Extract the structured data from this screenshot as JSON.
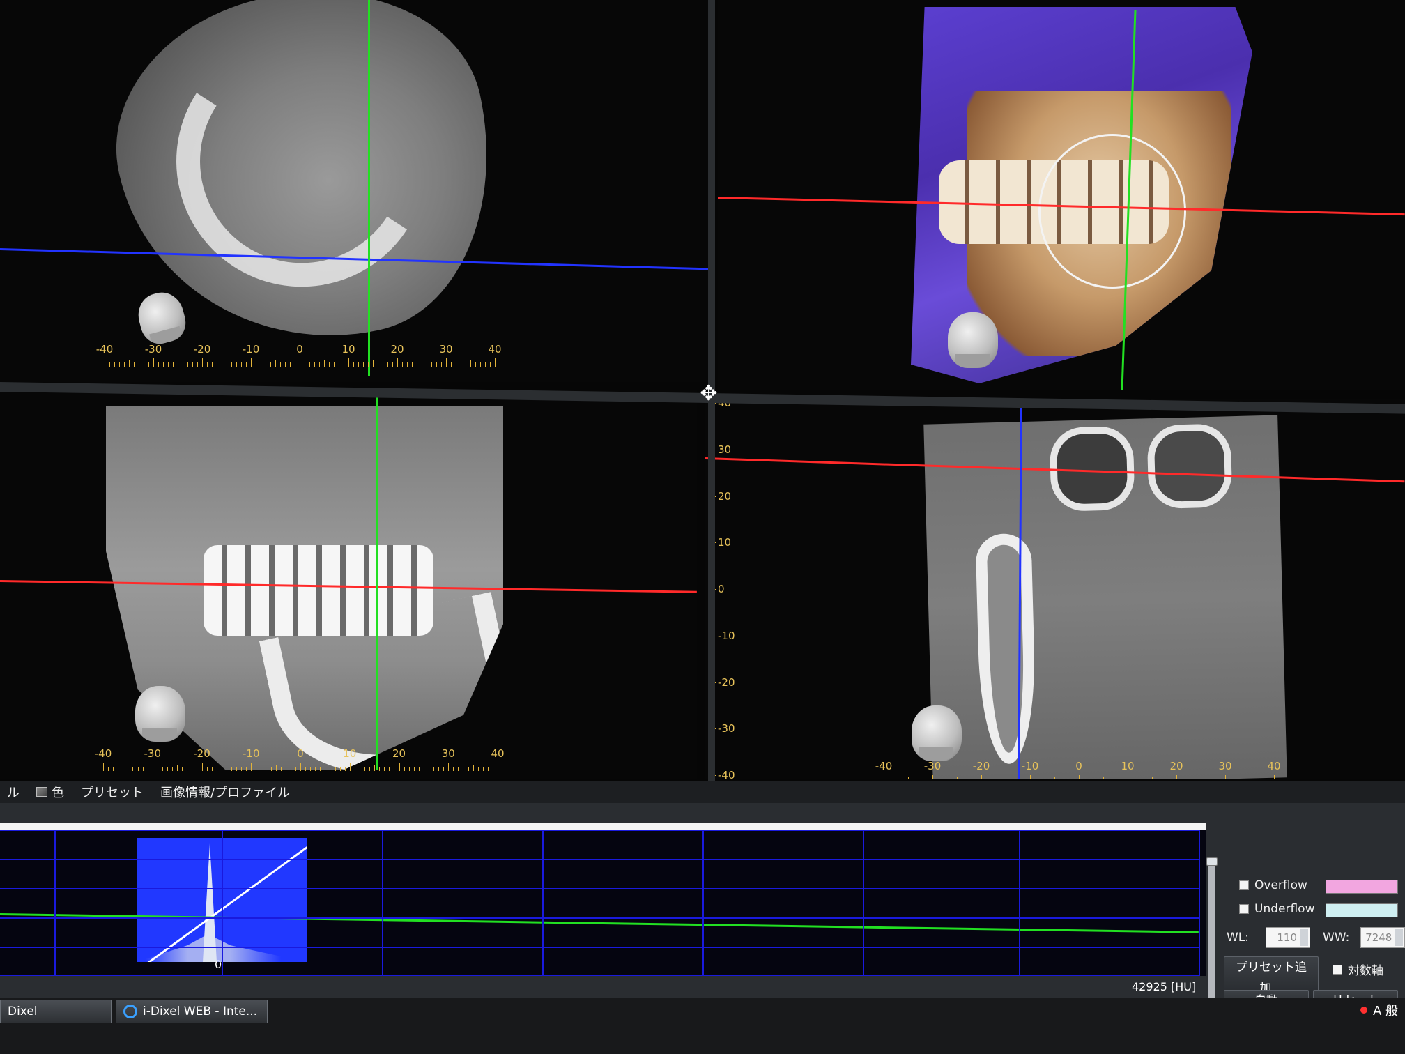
{
  "viewer": {
    "ruler_labels": [
      "-40",
      "-30",
      "-20",
      "-10",
      "0",
      "10",
      "20",
      "30",
      "40"
    ],
    "vruler_labels": [
      "40",
      "30",
      "20",
      "10",
      "0",
      "-10",
      "-20",
      "-30",
      "-40"
    ]
  },
  "tabs": {
    "partial_left": "ル",
    "color": "色",
    "preset": "プリセット",
    "image_info": "画像情報/プロファイル"
  },
  "histogram": {
    "zero_label": "0",
    "max_label": "42925 [HU]"
  },
  "side_panel": {
    "overflow_label": "Overflow",
    "underflow_label": "Underflow",
    "overflow_color": "#f2a6e0",
    "underflow_color": "#cfeff2",
    "wl_label": "WL:",
    "wl_value": "110",
    "ww_label": "WW:",
    "ww_value": "7248",
    "add_preset": "プリセット追加...",
    "log_axis": "対数軸",
    "auto": "自動",
    "reset": "リセット"
  },
  "taskbar": {
    "item1": "Dixel",
    "item2": "i-Dixel WEB - Inte...",
    "tray_text": "A 般"
  }
}
